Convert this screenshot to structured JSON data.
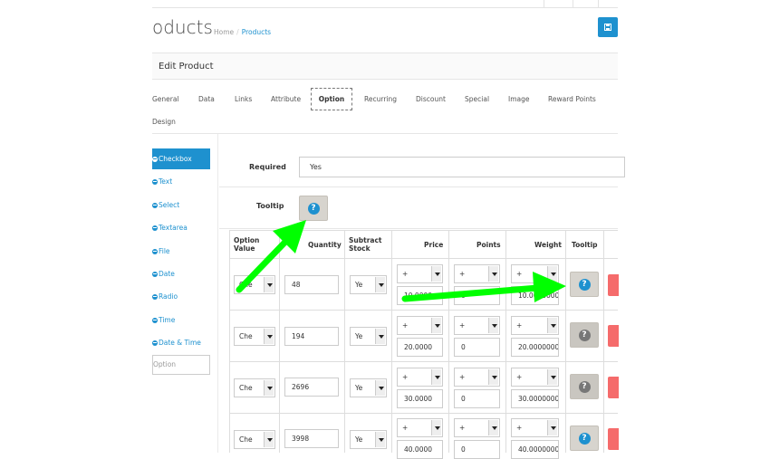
{
  "header": {
    "title": "oducts",
    "breadcrumb": {
      "home": "Home",
      "separator": "/",
      "current": "Products"
    }
  },
  "panel": {
    "title": "Edit Product"
  },
  "tabs": [
    "General",
    "Data",
    "Links",
    "Attribute",
    "Option",
    "Recurring",
    "Discount",
    "Special",
    "Image",
    "Reward Points",
    "Design"
  ],
  "active_tab": "Option",
  "sidebar": {
    "items": [
      "Checkbox",
      "Text",
      "Select",
      "Textarea",
      "File",
      "Date",
      "Radio",
      "Time",
      "Date & Time"
    ],
    "active": "Checkbox",
    "option_placeholder": "Option"
  },
  "form": {
    "required_label": "Required",
    "required_value": "Yes",
    "tooltip_label": "Tooltip"
  },
  "table": {
    "headers": {
      "option_value_1": "Option",
      "option_value_2": "Value",
      "quantity": "Quantity",
      "subtract_1": "Subtract",
      "subtract_2": "Stock",
      "price": "Price",
      "points": "Points",
      "weight": "Weight",
      "tooltip": "Tooltip"
    },
    "rows": [
      {
        "option": "Che",
        "quantity": "48",
        "subtract": "Ye",
        "price_prefix": "+",
        "price": "10.0000",
        "points_prefix": "+",
        "points": "0",
        "weight_prefix": "+",
        "weight": "10.00000000",
        "tooltip_style": "blue"
      },
      {
        "option": "Che",
        "quantity": "194",
        "subtract": "Ye",
        "price_prefix": "+",
        "price": "20.0000",
        "points_prefix": "+",
        "points": "0",
        "weight_prefix": "+",
        "weight": "20.00000000",
        "tooltip_style": "gray"
      },
      {
        "option": "Che",
        "quantity": "2696",
        "subtract": "Ye",
        "price_prefix": "+",
        "price": "30.0000",
        "points_prefix": "+",
        "points": "0",
        "weight_prefix": "+",
        "weight": "30.00000000",
        "tooltip_style": "gray"
      },
      {
        "option": "Che",
        "quantity": "3998",
        "subtract": "Ye",
        "price_prefix": "+",
        "price": "40.0000",
        "points_prefix": "+",
        "points": "0",
        "weight_prefix": "+",
        "weight": "40.00000000",
        "tooltip_style": "blue"
      }
    ]
  },
  "colors": {
    "accent": "#1e91cf",
    "danger": "#f56b6b",
    "annotation_arrow": "#00ff00"
  },
  "icons": {
    "save": "save-icon",
    "tooltip": "question-circle-icon",
    "remove": "minus-circle-icon"
  }
}
